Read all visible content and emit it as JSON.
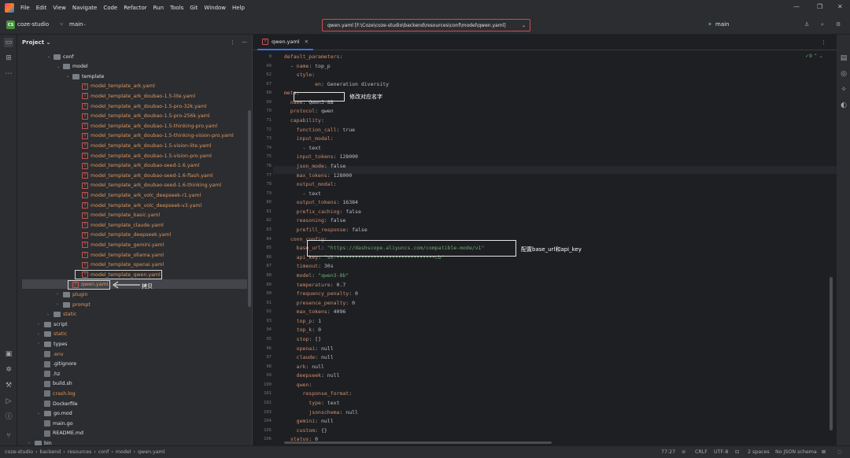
{
  "menu": [
    "File",
    "Edit",
    "View",
    "Navigate",
    "Code",
    "Refactor",
    "Run",
    "Tools",
    "Git",
    "Window",
    "Help"
  ],
  "toolbar": {
    "project_badge": "CS",
    "project_name": "coze-studio",
    "branch": "main",
    "file_path": "qwen.yaml [F:\\Coze\\coze-studio\\backend\\resources\\conf\\model\\qwen.yaml]",
    "run_branch": "main"
  },
  "project_panel": {
    "title": "Project",
    "tree": [
      {
        "label": "conf",
        "type": "folder",
        "indent": 0,
        "color": "white",
        "expanded": true
      },
      {
        "label": "model",
        "type": "folder",
        "indent": 1,
        "color": "white",
        "expanded": true
      },
      {
        "label": "template",
        "type": "folder",
        "indent": 2,
        "color": "white",
        "expanded": true
      },
      {
        "label": "model_template_ark.yaml",
        "type": "yaml",
        "indent": 3,
        "color": "orange"
      },
      {
        "label": "model_template_ark_doubao-1.5-lite.yaml",
        "type": "yaml",
        "indent": 3,
        "color": "orange"
      },
      {
        "label": "model_template_ark_doubao-1.5-pro-32k.yaml",
        "type": "yaml",
        "indent": 3,
        "color": "orange"
      },
      {
        "label": "model_template_ark_doubao-1.5-pro-256k.yaml",
        "type": "yaml",
        "indent": 3,
        "color": "orange"
      },
      {
        "label": "model_template_ark_doubao-1.5-thinking-pro.yaml",
        "type": "yaml",
        "indent": 3,
        "color": "orange"
      },
      {
        "label": "model_template_ark_doubao-1.5-thinking-vision-pro.yaml",
        "type": "yaml",
        "indent": 3,
        "color": "orange"
      },
      {
        "label": "model_template_ark_doubao-1.5-vision-lite.yaml",
        "type": "yaml",
        "indent": 3,
        "color": "orange"
      },
      {
        "label": "model_template_ark_doubao-1.5-vision-pro.yaml",
        "type": "yaml",
        "indent": 3,
        "color": "orange"
      },
      {
        "label": "model_template_ark_doubao-seed-1.6.yaml",
        "type": "yaml",
        "indent": 3,
        "color": "orange"
      },
      {
        "label": "model_template_ark_doubao-seed-1.6-flash.yaml",
        "type": "yaml",
        "indent": 3,
        "color": "orange"
      },
      {
        "label": "model_template_ark_doubao-seed-1.6-thinking.yaml",
        "type": "yaml",
        "indent": 3,
        "color": "orange"
      },
      {
        "label": "model_template_ark_volc_deepseek-r1.yaml",
        "type": "yaml",
        "indent": 3,
        "color": "orange"
      },
      {
        "label": "model_template_ark_volc_deepseek-v3.yaml",
        "type": "yaml",
        "indent": 3,
        "color": "orange"
      },
      {
        "label": "model_template_basic.yaml",
        "type": "yaml",
        "indent": 3,
        "color": "orange"
      },
      {
        "label": "model_template_claude.yaml",
        "type": "yaml",
        "indent": 3,
        "color": "orange"
      },
      {
        "label": "model_template_deepseek.yaml",
        "type": "yaml",
        "indent": 3,
        "color": "orange"
      },
      {
        "label": "model_template_gemini.yaml",
        "type": "yaml",
        "indent": 3,
        "color": "orange"
      },
      {
        "label": "model_template_ollama.yaml",
        "type": "yaml",
        "indent": 3,
        "color": "orange"
      },
      {
        "label": "model_template_openai.yaml",
        "type": "yaml",
        "indent": 3,
        "color": "orange"
      },
      {
        "label": "model_template_qwen.yaml",
        "type": "yaml",
        "indent": 3,
        "color": "orange"
      },
      {
        "label": "qwen.yaml",
        "type": "yaml",
        "indent": 2,
        "color": "orange"
      },
      {
        "label": "plugin",
        "type": "folder",
        "indent": 1,
        "color": "orange",
        "expanded": false
      },
      {
        "label": "prompt",
        "type": "folder",
        "indent": 1,
        "color": "orange",
        "expanded": false
      },
      {
        "label": "static",
        "type": "folder",
        "indent": 0,
        "color": "orange",
        "expanded": false
      },
      {
        "label": "script",
        "type": "folder",
        "indent": -1,
        "color": "white",
        "expanded": false
      },
      {
        "label": "static",
        "type": "folder",
        "indent": -1,
        "color": "orange",
        "expanded": false
      },
      {
        "label": "types",
        "type": "folder",
        "indent": -1,
        "color": "white",
        "expanded": false
      },
      {
        "label": ".env",
        "type": "file",
        "indent": -1,
        "color": "orange"
      },
      {
        "label": ".gitignore",
        "type": "file",
        "indent": -1,
        "color": "white"
      },
      {
        "label": ".hz",
        "type": "file",
        "indent": -1,
        "color": "white"
      },
      {
        "label": "build.sh",
        "type": "file",
        "indent": -1,
        "color": "white"
      },
      {
        "label": "crash.log",
        "type": "file",
        "indent": -1,
        "color": "orange"
      },
      {
        "label": "Dockerfile",
        "type": "file",
        "indent": -1,
        "color": "white"
      },
      {
        "label": "go.mod",
        "type": "folder",
        "indent": -1,
        "color": "white",
        "expanded": false
      },
      {
        "label": "main.go",
        "type": "file",
        "indent": -1,
        "color": "white"
      },
      {
        "label": "README.md",
        "type": "file",
        "indent": -1,
        "color": "white"
      },
      {
        "label": "bin",
        "type": "folder",
        "indent": -2,
        "color": "white",
        "expanded": false
      }
    ],
    "copy_annotation": "拷贝"
  },
  "editor": {
    "tab_label": "qwen.yaml",
    "inspection_count": "9",
    "lines": [
      {
        "n": "8",
        "code": "default_parameters:"
      },
      {
        "n": "49",
        "code": "  - name: top_p"
      },
      {
        "n": "62",
        "code": "    style:"
      },
      {
        "n": "67",
        "code": "          en: Generation diversity"
      },
      {
        "n": "68",
        "code": "meta:"
      },
      {
        "n": "69",
        "code": "  name: Qwen3-8B"
      },
      {
        "n": "70",
        "code": "  protocol: qwen"
      },
      {
        "n": "71",
        "code": "  capability:"
      },
      {
        "n": "72",
        "code": "    function_call: true"
      },
      {
        "n": "73",
        "code": "    input_modal:"
      },
      {
        "n": "74",
        "code": "      - text"
      },
      {
        "n": "75",
        "code": "    input_tokens: 128000"
      },
      {
        "n": "76",
        "code": "    json_mode: false"
      },
      {
        "n": "77",
        "code": "    max_tokens: 128000"
      },
      {
        "n": "78",
        "code": "    output_modal:"
      },
      {
        "n": "79",
        "code": "      - text"
      },
      {
        "n": "80",
        "code": "    output_tokens: 16384"
      },
      {
        "n": "81",
        "code": "    prefix_caching: false"
      },
      {
        "n": "82",
        "code": "    reasoning: false"
      },
      {
        "n": "83",
        "code": "    prefill_response: false"
      },
      {
        "n": "84",
        "code": "  conn_config:"
      },
      {
        "n": "85",
        "code": "    base_url: \"https://dashscope.aliyuncs.com/compatible-mode/v1\""
      },
      {
        "n": "86",
        "code": "    api_key: \"sk-••••••••••••••••••••••••••••••••cb\""
      },
      {
        "n": "87",
        "code": "    timeout: 30s"
      },
      {
        "n": "88",
        "code": "    model: \"qwen3-8b\""
      },
      {
        "n": "89",
        "code": "    temperature: 0.7"
      },
      {
        "n": "90",
        "code": "    frequency_penalty: 0"
      },
      {
        "n": "91",
        "code": "    presence_penalty: 0"
      },
      {
        "n": "92",
        "code": "    max_tokens: 4096"
      },
      {
        "n": "93",
        "code": "    top_p: 1"
      },
      {
        "n": "94",
        "code": "    top_k: 0"
      },
      {
        "n": "95",
        "code": "    stop: []"
      },
      {
        "n": "96",
        "code": "    openai: null"
      },
      {
        "n": "97",
        "code": "    claude: null"
      },
      {
        "n": "98",
        "code": "    ark: null"
      },
      {
        "n": "99",
        "code": "    deepseek: null"
      },
      {
        "n": "100",
        "code": "    qwen:"
      },
      {
        "n": "101",
        "code": "      response_format:"
      },
      {
        "n": "102",
        "code": "        type: text"
      },
      {
        "n": "103",
        "code": "        jsonschema: null"
      },
      {
        "n": "104",
        "code": "    gemini: null"
      },
      {
        "n": "105",
        "code": "    custom: {}"
      },
      {
        "n": "106",
        "code": "  status: 0"
      },
      {
        "n": "107",
        "code": ""
      }
    ],
    "annotation_name": "修改对应名字",
    "annotation_conn": "配置base_url和api_key"
  },
  "statusbar": {
    "breadcrumb": [
      "coze-studio",
      "backend",
      "resources",
      "conf",
      "model",
      "qwen.yaml"
    ],
    "position": "77:27",
    "line_sep": "CRLF",
    "encoding": "UTF-8",
    "indent": "2 spaces",
    "schema": "No JSON schema"
  }
}
